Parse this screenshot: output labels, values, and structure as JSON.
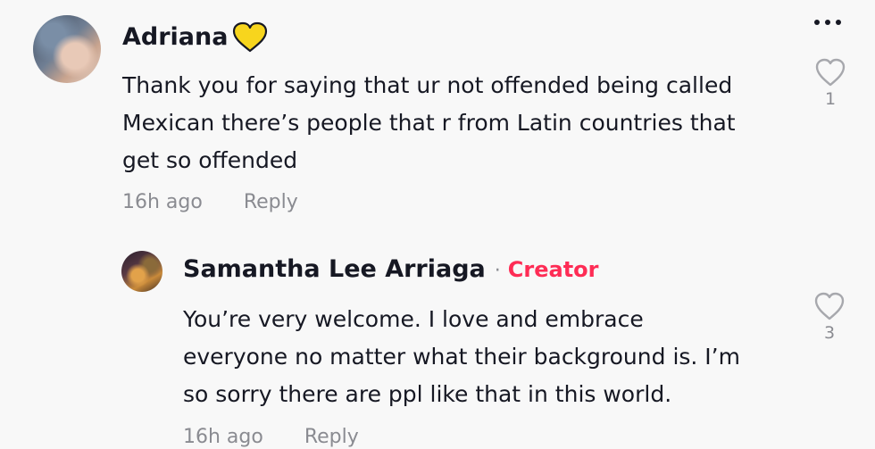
{
  "comment": {
    "author": "Adriana",
    "author_emoji": "yellow-heart",
    "lines": [
      "Thank you for saying that ur not offended being called",
      "Mexican there’s people that r from Latin countries that",
      "get so offended"
    ],
    "time": "16h ago",
    "reply_label": "Reply",
    "like_count": "1"
  },
  "reply": {
    "author": "Samantha Lee Arriaga",
    "separator": "·",
    "badge": "Creator",
    "lines": [
      "You’re very welcome. I love and embrace",
      "everyone no matter what their background is. I’m",
      "so sorry there are ppl like that in this world."
    ],
    "time": "16h ago",
    "reply_label": "Reply",
    "like_count": "3"
  },
  "icons": {
    "more": "more-options-icon",
    "like": "heart-outline-icon"
  },
  "colors": {
    "creator_badge": "#fe2c55",
    "meta_text": "#8a8b91",
    "emoji_heart": "#f7d51d"
  }
}
